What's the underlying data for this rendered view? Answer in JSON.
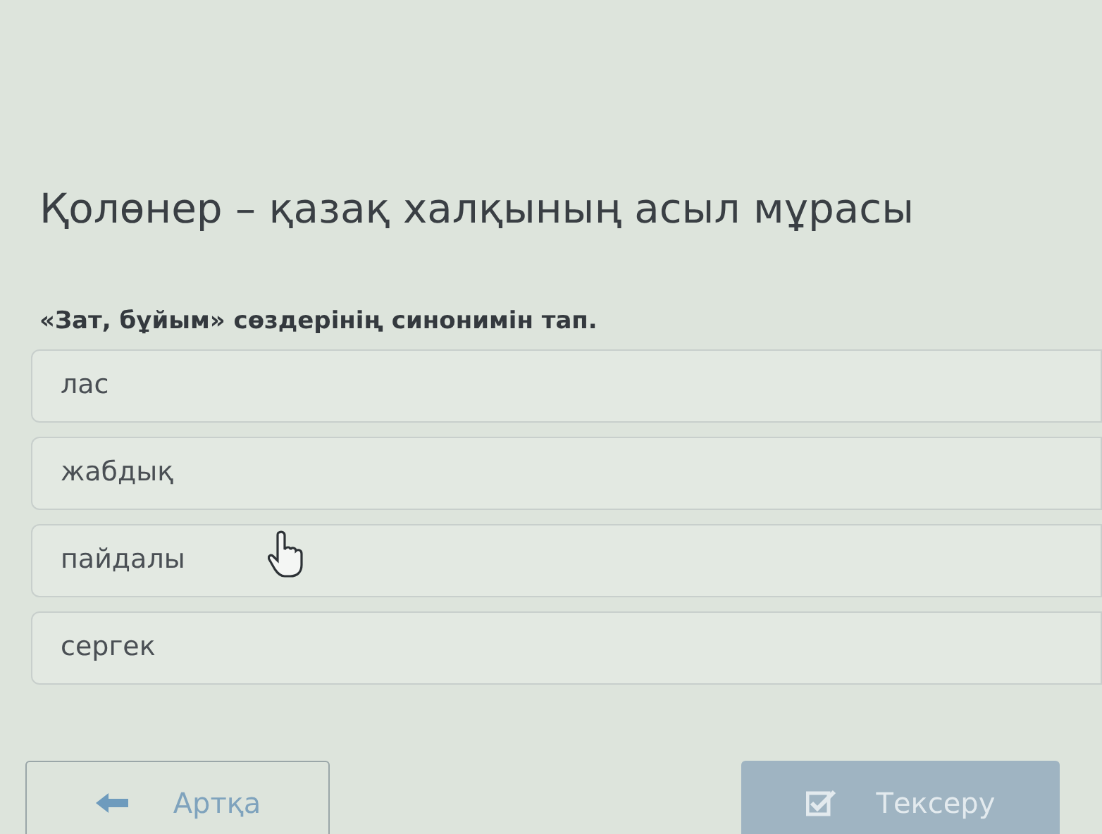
{
  "title": "Қолөнер – қазақ халқының асыл мұрасы",
  "question": "«Зат, бұйым» сөздерінің синонимін тап.",
  "options": [
    {
      "label": "лас",
      "selected": false
    },
    {
      "label": "жабдық",
      "selected": false
    },
    {
      "label": "пайдалы",
      "selected": false
    },
    {
      "label": "сергек",
      "selected": false
    }
  ],
  "back_button": {
    "label": "Артқа",
    "disabled": false
  },
  "check_button": {
    "label": "Тексеру",
    "disabled": true
  }
}
